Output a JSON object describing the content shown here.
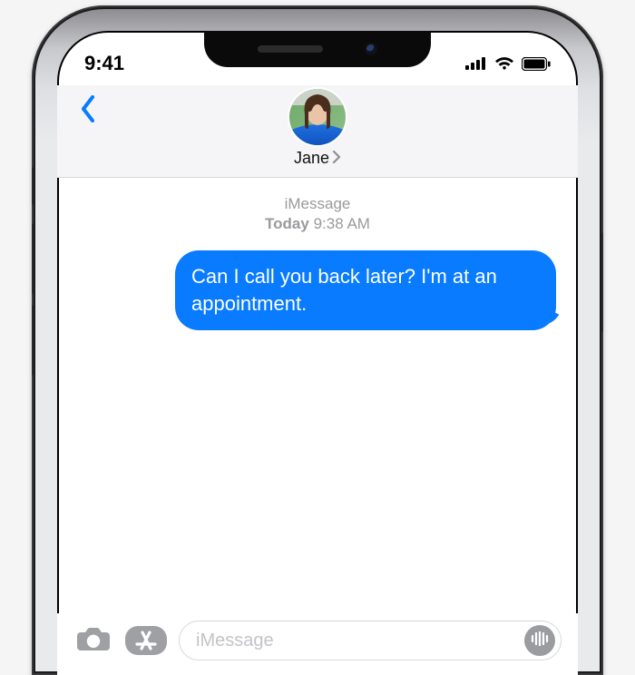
{
  "status": {
    "time": "9:41"
  },
  "header": {
    "contact_name": "Jane"
  },
  "thread": {
    "service_label": "iMessage",
    "timestamp_prefix": "Today",
    "timestamp_time": "9:38 AM",
    "messages": [
      {
        "from": "me",
        "text": "Can I call you back later? I'm at an appointment."
      }
    ]
  },
  "compose": {
    "placeholder": "iMessage"
  },
  "colors": {
    "accent": "#087bff",
    "bubble": "#087bff",
    "header_bg": "#f5f5f7",
    "muted": "#9a9a9e"
  }
}
